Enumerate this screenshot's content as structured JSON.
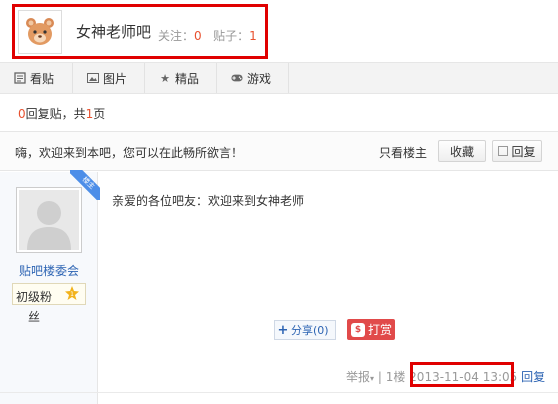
{
  "forum": {
    "name": "女神老师吧",
    "follow_label": "关注：",
    "follow_count": "0",
    "posts_label": "贴子：",
    "posts_count": "1"
  },
  "nav": {
    "tabs": [
      {
        "label": "看贴",
        "icon": "list-icon"
      },
      {
        "label": "图片",
        "icon": "image-icon"
      },
      {
        "label": "精品",
        "icon": "star-icon"
      },
      {
        "label": "游戏",
        "icon": "gamepad-icon"
      }
    ]
  },
  "page_info": {
    "reply_count": "0",
    "reply_label": "回复贴，共",
    "page_count": "1",
    "page_label": "页"
  },
  "toolbar": {
    "welcome": "嗨，欢迎来到本吧，您可以在此畅所欲言！",
    "only_host": "只看楼主",
    "favorite": "收藏",
    "reply": "回复"
  },
  "post": {
    "host_badge": "楼主",
    "user_name": "贴吧楼委会",
    "level_text": "初级粉",
    "level_text_wrap": "丝",
    "content": "亲爱的各位吧友：欢迎来到女神老师",
    "share_label": "分享(0)",
    "tip_label": "打赏",
    "report_label": "举报",
    "floor_label": "1楼",
    "date": "2013-11-04 13:05",
    "reply_label": "回复"
  },
  "colors": {
    "accent_red": "#e8512f",
    "link_blue": "#2d64b3",
    "highlight": "#e00000"
  }
}
